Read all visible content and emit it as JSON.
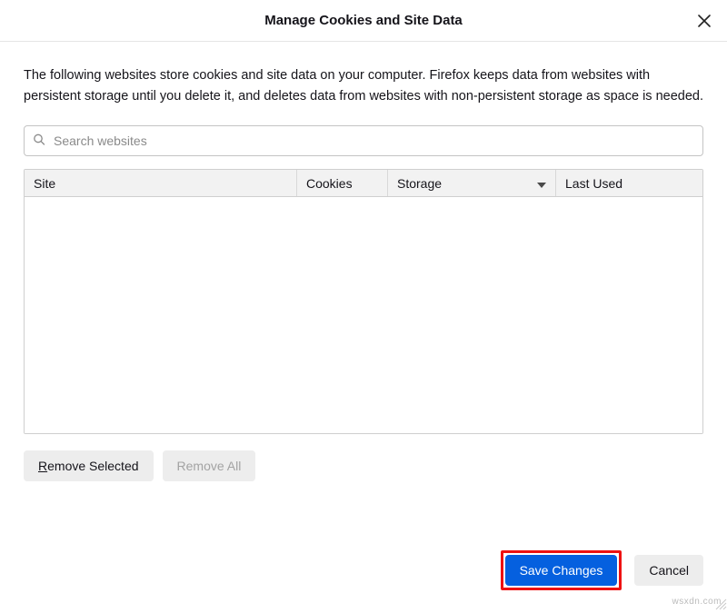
{
  "titlebar": {
    "title": "Manage Cookies and Site Data"
  },
  "description": "The following websites store cookies and site data on your computer. Firefox keeps data from websites with persistent storage until you delete it, and deletes data from websites with non-persistent storage as space is needed.",
  "search": {
    "placeholder": "Search websites"
  },
  "columns": {
    "site": "Site",
    "cookies": "Cookies",
    "storage": "Storage",
    "lastUsed": "Last Used"
  },
  "buttons": {
    "removeSelectedPrefix": "R",
    "removeSelectedRest": "emove Selected",
    "removeAll": "Remove All",
    "saveChanges": "Save Changes",
    "cancel": "Cancel"
  },
  "watermark": "wsxdn.com"
}
